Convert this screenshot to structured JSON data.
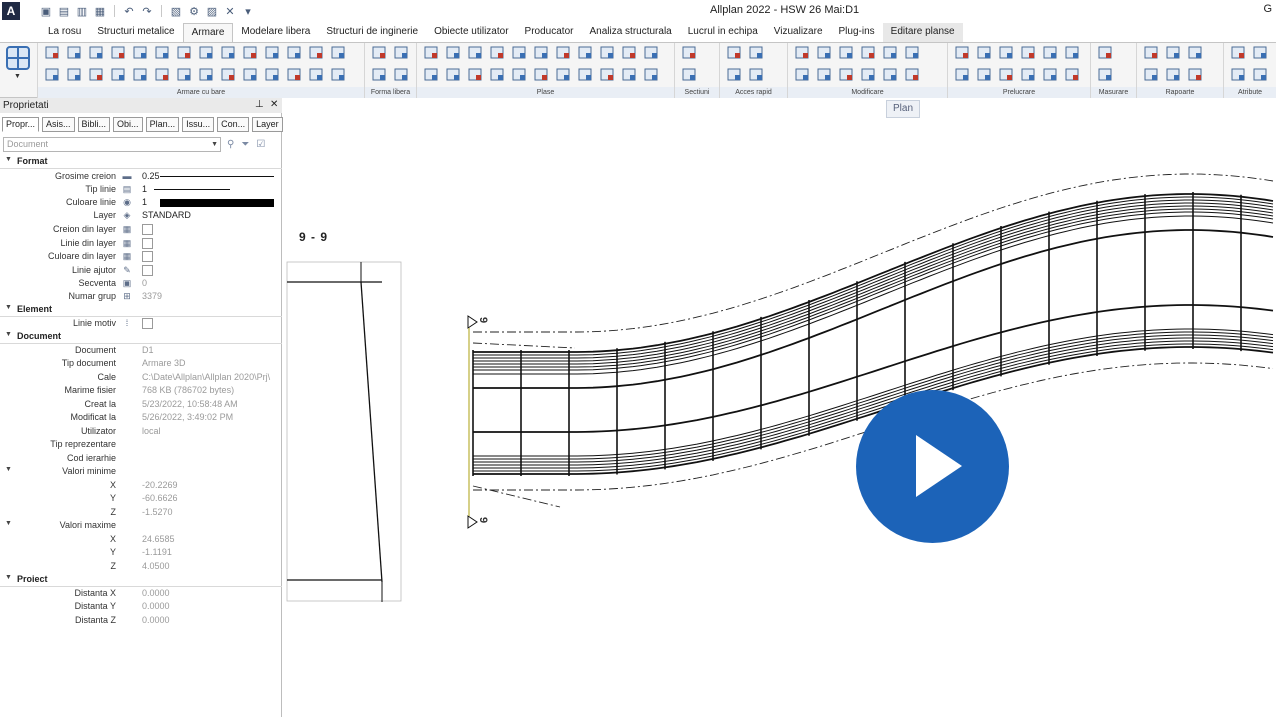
{
  "window": {
    "app_logo": "A",
    "title": "Allplan 2022 - HSW 26 Mai:D1",
    "user_initial": "G"
  },
  "quick_access": [
    "new-icon",
    "open-icon",
    "save-icon",
    "save-as-icon",
    "undo-icon",
    "redo-icon",
    "print-icon",
    "settings-icon",
    "view-icon"
  ],
  "ribbon": {
    "tabs": [
      "La rosu",
      "Structuri metalice",
      "Armare",
      "Modelare libera",
      "Structuri de inginerie",
      "Obiecte utilizator",
      "Producator",
      "Analiza structurala",
      "Lucrul in echipa",
      "Vizualizare",
      "Plug-ins",
      "Editare planse"
    ],
    "active_tab": "Armare",
    "groups": [
      "Armare cu bare",
      "Forma libera",
      "Plase",
      "Sectiuni",
      "Acces rapid",
      "Modificare",
      "Prelucrare",
      "Masurare",
      "Rapoarte",
      "Atribute"
    ]
  },
  "tooltip": {
    "text": "Plan"
  },
  "properties": {
    "title": "Proprietati",
    "pin_icon": "pin-icon",
    "close_icon": "close-icon",
    "tabs": [
      "Propr...",
      "Asis...",
      "Bibli...",
      "Obi...",
      "Plan...",
      "Issu...",
      "Con...",
      "Layer"
    ],
    "filter_placeholder": "Document",
    "sections": {
      "format": "Format",
      "element": "Element",
      "document": "Document",
      "proiect": "Proiect"
    },
    "format_rows": {
      "grosime_label": "Grosime creion",
      "grosime_value": "0.25",
      "tip_linie_label": "Tip linie",
      "tip_linie_value": "1",
      "culoare_label": "Culoare linie",
      "culoare_value": "1",
      "layer_label": "Layer",
      "layer_value": "STANDARD",
      "creion_din_layer": "Creion din layer",
      "linie_din_layer": "Linie din layer",
      "culoare_din_layer": "Culoare din layer",
      "linie_ajutor": "Linie ajutor",
      "secventa_label": "Secventa",
      "secventa_value": "0",
      "numar_grup_label": "Numar grup",
      "numar_grup_value": "3379"
    },
    "element_rows": {
      "linie_motiv": "Linie motiv"
    },
    "document_rows": {
      "document_label": "Document",
      "document_value": "D1",
      "tip_document_label": "Tip document",
      "tip_document_value": "Armare 3D",
      "cale_label": "Cale",
      "cale_value": "C:\\Date\\Allplan\\Allplan 2020\\Prj\\",
      "marime_label": "Marime fisier",
      "marime_value": "768 KB (786702 bytes)",
      "creat_label": "Creat la",
      "creat_value": "5/23/2022, 10:58:48 AM",
      "modificat_label": "Modificat la",
      "modificat_value": "5/26/2022, 3:49:02 PM",
      "utilizator_label": "Utilizator",
      "utilizator_value": "local",
      "tip_repr_label": "Tip reprezentare",
      "cod_ierarhie_label": "Cod ierarhie",
      "valori_minime": "Valori minime",
      "min_x": "-20.2269",
      "min_y": "-60.6626",
      "min_z": "-1.5270",
      "valori_maxime": "Valori maxime",
      "max_x": "24.6585",
      "max_y": "-1.1191",
      "max_z": "4.0500",
      "x_label": "X",
      "y_label": "Y",
      "z_label": "Z"
    },
    "proiect_rows": {
      "distanta_x_label": "Distanta X",
      "distanta_x_value": "0.0000",
      "distanta_y_label": "Distanta Y",
      "distanta_y_value": "0.0000",
      "distanta_z_label": "Distanta Z",
      "distanta_z_value": "0.0000"
    }
  },
  "canvas": {
    "section_label": "9 - 9",
    "cut_marker_top": "9",
    "cut_marker_bottom": "9"
  },
  "colors": {
    "play_button": "#1c63b8",
    "accent": "#3a6fb3"
  }
}
